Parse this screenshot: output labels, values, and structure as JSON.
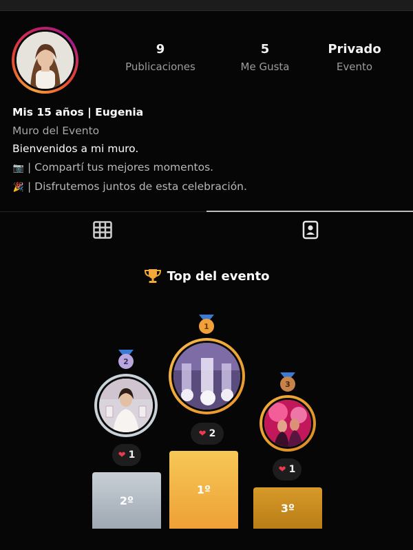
{
  "profile": {
    "avatar_name": "profile-avatar",
    "stats": [
      {
        "value": "9",
        "label": "Publicaciones"
      },
      {
        "value": "5",
        "label": "Me Gusta"
      },
      {
        "value": "Privado",
        "label": "Evento"
      }
    ],
    "bio": {
      "name": "Mis 15 años | Eugenia",
      "subtitle": "Muro del Evento",
      "welcome": "Bienvenidos a mi muro.",
      "line1_icon": "📷",
      "line1": "| Compartí tus mejores momentos.",
      "line2_icon": "🎉",
      "line2": "| Disfrutemos juntos de esta celebración."
    }
  },
  "tabs": {
    "grid_icon": "grid-icon",
    "tagged_icon": "tagged-person-icon",
    "active": "tagged"
  },
  "ranking": {
    "title": "Top del evento",
    "title_icon": "trophy-icon",
    "podium": [
      {
        "place": "second",
        "medal_number": "2",
        "likes": "1",
        "block_label": "2º",
        "medal_color": "#b9a6df"
      },
      {
        "place": "first",
        "medal_number": "1",
        "likes": "2",
        "block_label": "1º",
        "medal_color": "#f2a13a"
      },
      {
        "place": "third",
        "medal_number": "3",
        "likes": "1",
        "block_label": "3º",
        "medal_color": "#c7834a"
      }
    ]
  },
  "colors": {
    "background": "#060606",
    "accent_gold": "#f2a93a",
    "heart": "#ee3a4f",
    "silver_block": "#b7bfc8",
    "gold_block": "#f3b33f",
    "bronze_block": "#c88a1f"
  }
}
